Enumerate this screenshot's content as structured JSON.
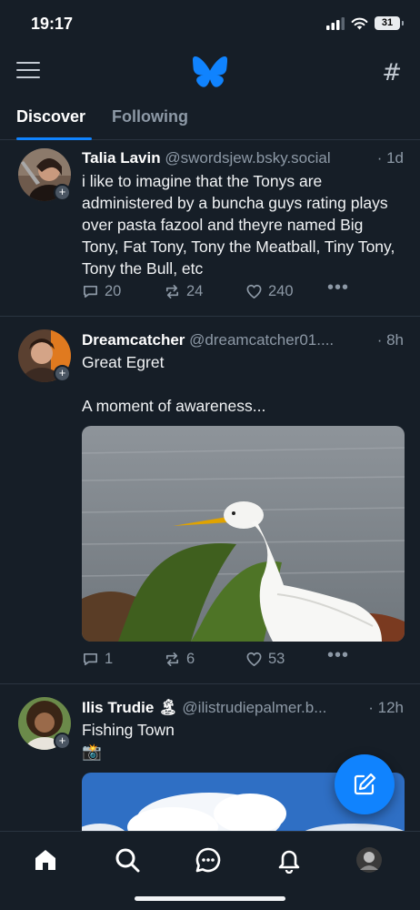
{
  "status_bar": {
    "time": "19:17",
    "battery": "31"
  },
  "top_bar": {
    "logo": "butterfly-icon",
    "menu_icon": "menu-icon",
    "feeds_icon": "hash-icon",
    "hash_glyph": "#"
  },
  "tabs": [
    {
      "label": "Discover",
      "active": true
    },
    {
      "label": "Following",
      "active": false
    }
  ],
  "posts": [
    {
      "author": "Talia Lavin",
      "handle": "@swordsjew.bsky.social",
      "time": "· 1d",
      "text": "i like to imagine that the Tonys are administered by a buncha guys rating plays over pasta fazool and theyre named Big Tony, Fat Tony, Tony the Meatball, Tiny Tony, Tony the Bull, etc",
      "replies": "20",
      "reposts": "24",
      "likes": "240"
    },
    {
      "author": "Dreamcatcher",
      "handle": "@dreamcatcher01....",
      "time": "· 8h",
      "text": "Great Egret\n\nA moment of awareness...",
      "image": "great-egret-photo",
      "replies": "1",
      "reposts": "6",
      "likes": "53"
    },
    {
      "author": "Ilis Trudie 🏝",
      "handle": "@ilistrudiepalmer.b...",
      "time": "· 12h",
      "text": "Fishing Town\n📸",
      "image": "sky-clouds-photo"
    }
  ],
  "fab": {
    "icon": "compose-icon"
  },
  "bottom_nav": [
    "home-icon",
    "search-icon",
    "chat-icon",
    "bell-icon",
    "profile-avatar"
  ],
  "colors": {
    "background": "#161e27",
    "accent": "#1083fe",
    "muted": "#8d99a6",
    "divider": "#2a3440"
  }
}
